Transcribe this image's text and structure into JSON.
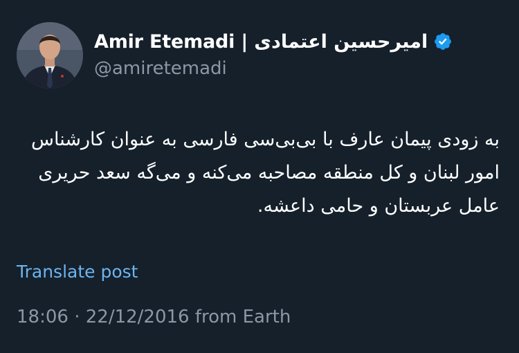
{
  "author": {
    "display_name": "Amir Etemadi | امیرحسین اعتمادی",
    "handle": "@amiretemadi",
    "verified_icon": "verified-badge-icon",
    "badge_color": "#1d9bf0"
  },
  "tweet": {
    "text": "به زودی پیمان عارف با بی‌بی‌سی فارسی به عنوان کارشناس امور لبنان و کل منطقه مصاحبه می‌کنه و می‌گه سعد حریری عامل عربستان و حامی داعشه.",
    "translate_label": "Translate post",
    "time": "18:06",
    "separator": " · ",
    "date": "22/12/2016",
    "source": " from Earth"
  },
  "colors": {
    "background": "#15202b",
    "secondary_text": "#8b98a5",
    "link": "#6cb4ef"
  }
}
